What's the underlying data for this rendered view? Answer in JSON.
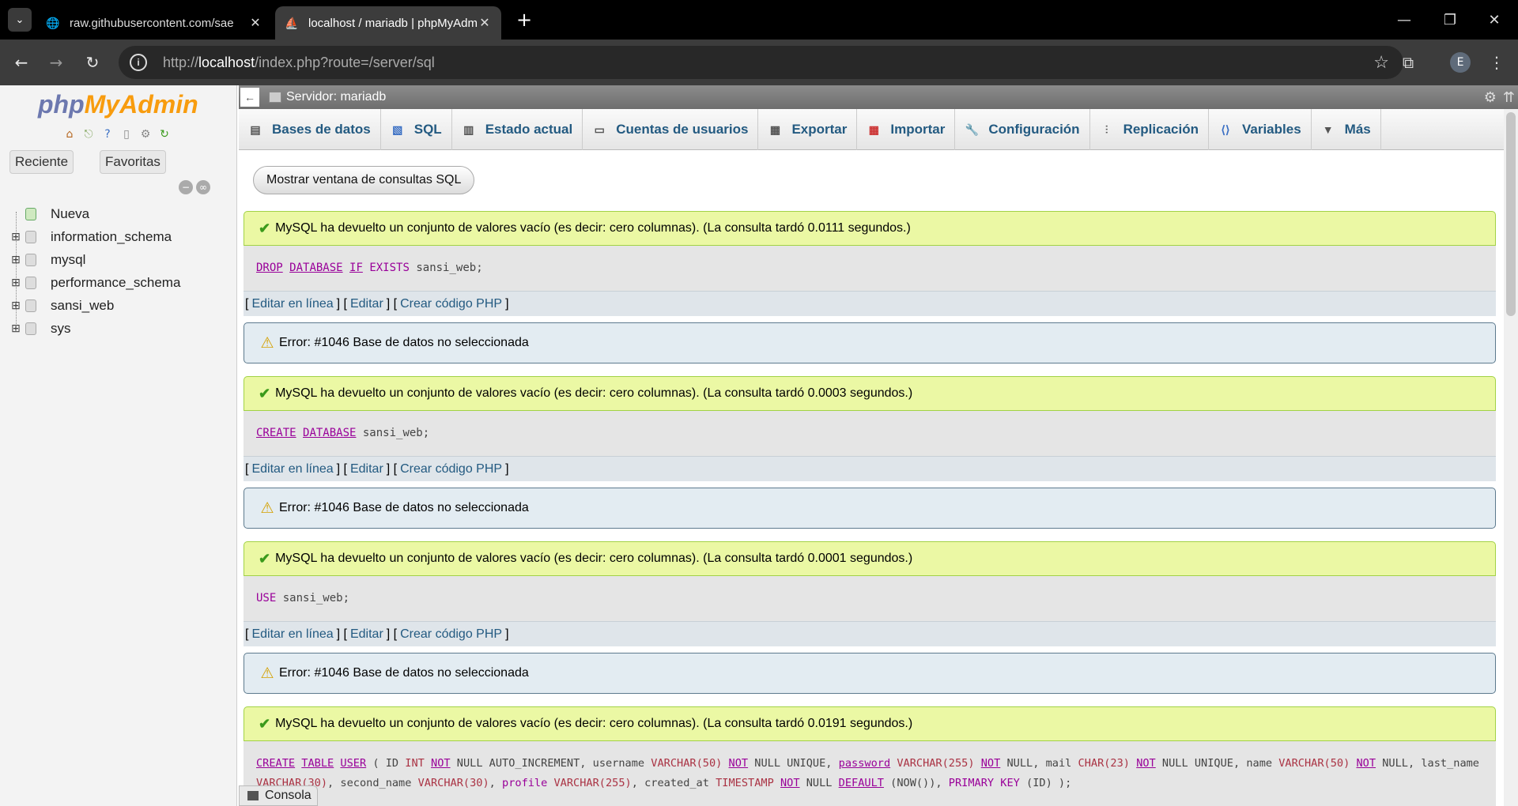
{
  "browser": {
    "tabs": [
      {
        "title": "raw.githubusercontent.com/sae",
        "active": false
      },
      {
        "title": "localhost / mariadb | phpMyAdmin",
        "active": true
      }
    ],
    "url_scheme": "http://",
    "url_host": "localhost",
    "url_path": "/index.php?route=/server/sql",
    "profile_initial": "E"
  },
  "left": {
    "logo_php": "php",
    "logo_my": "MyAdmin",
    "recent_label": "Reciente",
    "favorites_label": "Favoritas",
    "tree": [
      {
        "label": "Nueva",
        "type": "new"
      },
      {
        "label": "information_schema",
        "type": "db"
      },
      {
        "label": "mysql",
        "type": "db"
      },
      {
        "label": "performance_schema",
        "type": "db"
      },
      {
        "label": "sansi_web",
        "type": "db"
      },
      {
        "label": "sys",
        "type": "db"
      }
    ]
  },
  "server_bar": {
    "title": "Servidor: mariadb"
  },
  "nav_tabs": [
    {
      "label": "Bases de datos",
      "icon": "database-icon"
    },
    {
      "label": "SQL",
      "icon": "sql-icon"
    },
    {
      "label": "Estado actual",
      "icon": "status-icon"
    },
    {
      "label": "Cuentas de usuarios",
      "icon": "users-icon"
    },
    {
      "label": "Exportar",
      "icon": "export-icon"
    },
    {
      "label": "Importar",
      "icon": "import-icon"
    },
    {
      "label": "Configuración",
      "icon": "wrench-icon"
    },
    {
      "label": "Replicación",
      "icon": "replication-icon"
    },
    {
      "label": "Variables",
      "icon": "variables-icon"
    },
    {
      "label": "Más",
      "icon": "chevron-down-icon"
    }
  ],
  "sql_window_button": "Mostrar ventana de consultas SQL",
  "links": {
    "edit_inline": "Editar en línea",
    "edit": "Editar",
    "php_code": "Crear código PHP"
  },
  "results": [
    {
      "message": "MySQL ha devuelto un conjunto de valores vacío (es decir: cero columnas). (La consulta tardó 0.0111 segundos.)",
      "error": "Error: #1046 Base de datos no seleccionada"
    },
    {
      "message": "MySQL ha devuelto un conjunto de valores vacío (es decir: cero columnas). (La consulta tardó 0.0003 segundos.)",
      "error": "Error: #1046 Base de datos no seleccionada"
    },
    {
      "message": "MySQL ha devuelto un conjunto de valores vacío (es decir: cero columnas). (La consulta tardó 0.0001 segundos.)",
      "error": "Error: #1046 Base de datos no seleccionada"
    },
    {
      "message": "MySQL ha devuelto un conjunto de valores vacío (es decir: cero columnas). (La consulta tardó 0.0191 segundos.)"
    }
  ],
  "queries": {
    "q1": {
      "kw1": "DROP",
      "kw2": "DATABASE",
      "kw3": "IF",
      "kw4": "EXISTS",
      "rest": " sansi_web;"
    },
    "q2": {
      "kw1": "CREATE",
      "kw2": "DATABASE",
      "rest": " sansi_web;"
    },
    "q3": {
      "kw1": "USE",
      "rest": " sansi_web;"
    },
    "q4": {
      "create": "CREATE",
      "table": "TABLE",
      "user": "USER",
      "p1": " ( ID ",
      "int": "INT",
      "not1": "NOT",
      "null1": " NULL AUTO_INCREMENT, username ",
      "varchar50": "VARCHAR(50)",
      "not2": "NOT",
      "nullunique1": " NULL UNIQUE, ",
      "password": "password",
      "varchar255": "VARCHAR(255)",
      "not3": "NOT",
      "null3": " NULL, mail ",
      "char23": "CHAR(23)",
      "not4": "NOT",
      "nullunique2": " NULL UNIQUE, name ",
      "varchar50b": "VARCHAR(50)",
      "not5": "NOT",
      "null5": "NULL",
      "p2": ", last_name ",
      "varchar30": "VARCHAR(30)",
      "p3": ", second_name ",
      "varchar30b": "VARCHAR(30)",
      "p4": ", ",
      "profile": "profile",
      "varchar255b": "VARCHAR(255)",
      "p5": ", created_at ",
      "timestamp": "TIMESTAMP",
      "not6": "NOT",
      "null6": " NULL ",
      "default": "DEFAULT",
      "now": " (NOW()), ",
      "primary": "PRIMARY KEY",
      "end": " (ID) );"
    }
  },
  "console_label": "Consola"
}
